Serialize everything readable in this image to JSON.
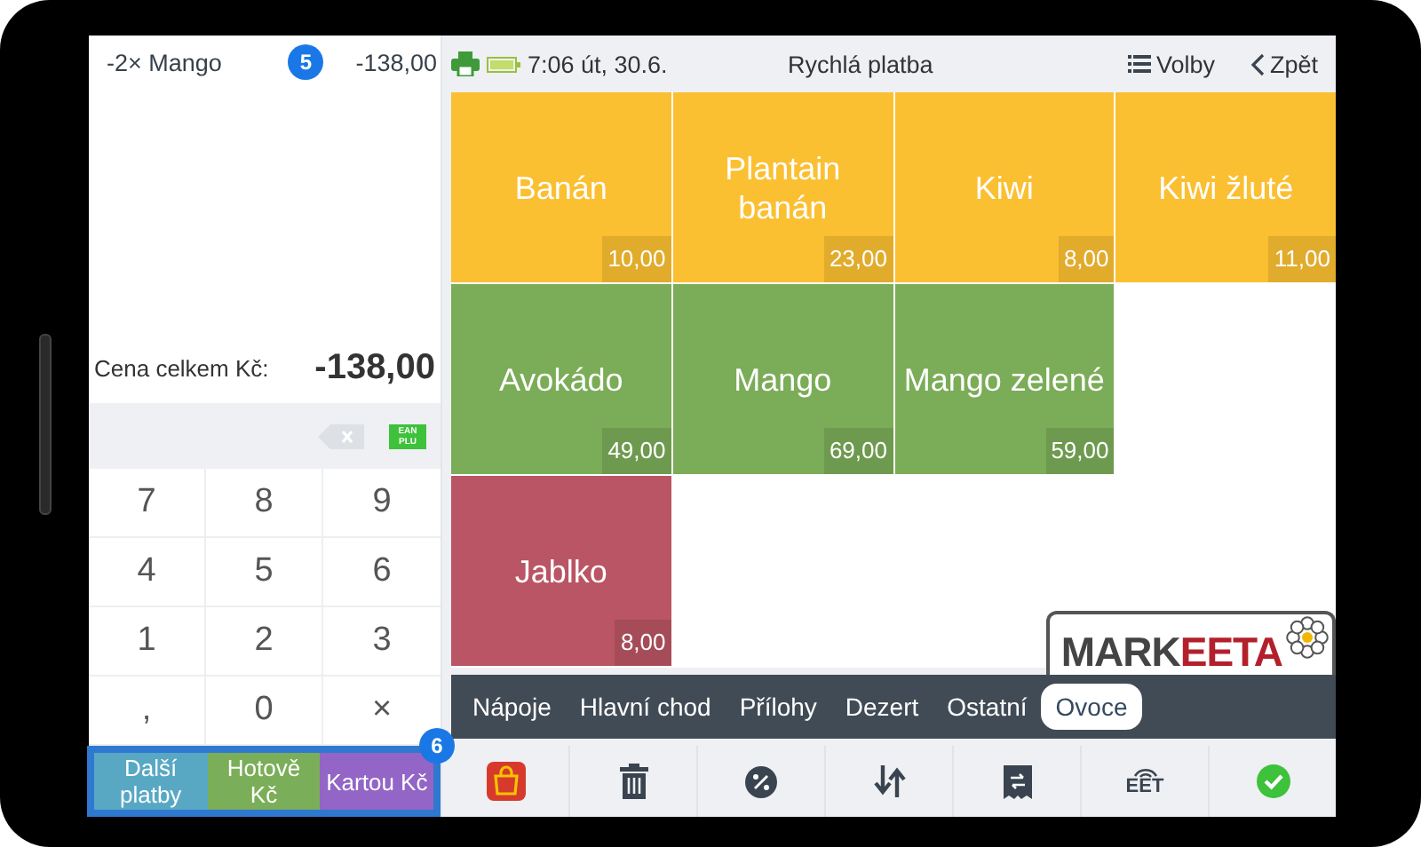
{
  "order": {
    "lines": [
      {
        "quantity": "-2×",
        "name": "Mango",
        "badge": "5",
        "amount": "-138,00"
      }
    ],
    "total_label": "Cena celkem Kč:",
    "total": "-138,00"
  },
  "input_bar": {
    "ean_plu": [
      "EAN",
      "PLU"
    ]
  },
  "keypad": [
    "7",
    "8",
    "9",
    "4",
    "5",
    "6",
    "1",
    "2",
    "3",
    ",",
    "0",
    "×"
  ],
  "payment": {
    "badge": "6",
    "buttons": [
      {
        "label": "Další platby",
        "color": "#58a8c4"
      },
      {
        "label": "Hotově Kč",
        "color": "#7bae58"
      },
      {
        "label": "Kartou Kč",
        "color": "#9265c6"
      }
    ]
  },
  "header": {
    "time": "7:06 út, 30.6.",
    "title": "Rychlá platba",
    "options": "Volby",
    "back": "Zpět"
  },
  "product_rows": [
    [
      {
        "name": "Banán",
        "price": "10,00",
        "color": "#fbbf32"
      },
      {
        "name": "Plantain banán",
        "price": "23,00",
        "color": "#fbbf32"
      },
      {
        "name": "Kiwi",
        "price": "8,00",
        "color": "#fbbf32"
      },
      {
        "name": "Kiwi žluté",
        "price": "11,00",
        "color": "#fbbf32"
      }
    ],
    [
      {
        "name": "Avokádo",
        "price": "49,00",
        "color": "#7bac58"
      },
      {
        "name": "Mango",
        "price": "69,00",
        "color": "#7bac58"
      },
      {
        "name": "Mango zelené",
        "price": "59,00",
        "color": "#7bac58"
      }
    ],
    [
      {
        "name": "Jablko",
        "price": "8,00",
        "color": "#b95564"
      }
    ]
  ],
  "logo": {
    "text": "MARK",
    "accent": "EETA"
  },
  "categories": [
    {
      "label": "Nápoje",
      "selected": false
    },
    {
      "label": "Hlavní chod",
      "selected": false
    },
    {
      "label": "Přílohy",
      "selected": false
    },
    {
      "label": "Dezert",
      "selected": false
    },
    {
      "label": "Ostatní",
      "selected": false
    },
    {
      "label": "Ovoce",
      "selected": true
    }
  ],
  "toolbar": [
    {
      "kind": "bag"
    },
    {
      "kind": "trash"
    },
    {
      "kind": "percent"
    },
    {
      "kind": "sort"
    },
    {
      "kind": "receipt"
    },
    {
      "kind": "eet",
      "label": "EET"
    },
    {
      "kind": "check"
    }
  ]
}
